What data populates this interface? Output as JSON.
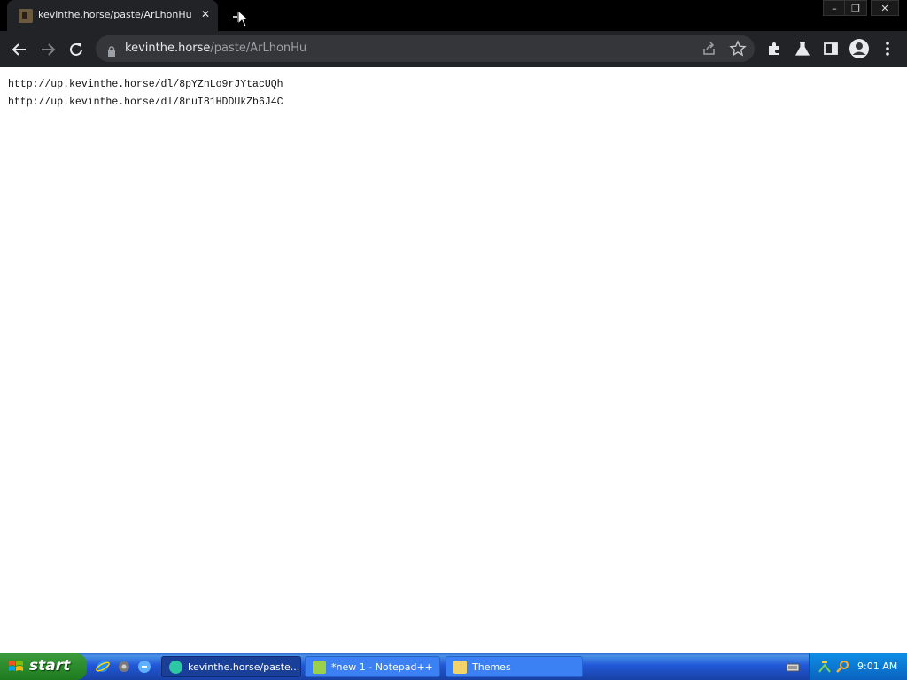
{
  "browser": {
    "tab": {
      "title": "kevinthe.horse/paste/ArLhonHu",
      "close_glyph": "✕"
    },
    "window_controls": {
      "minimize": "–",
      "restore": "❐",
      "close": "✕"
    },
    "omnibox": {
      "host": "kevinthe.horse",
      "path": "/paste/ArLhonHu"
    }
  },
  "page": {
    "lines": [
      "http://up.kevinthe.horse/dl/8pYZnLo9rJYtacUQh",
      "http://up.kevinthe.horse/dl/8nuI81HDDUkZb6J4C"
    ]
  },
  "taskbar": {
    "start_label": "start",
    "items": [
      {
        "label": "kevinthe.horse/paste...",
        "active": true
      },
      {
        "label": "*new 1 - Notepad++",
        "active": false
      },
      {
        "label": "Themes",
        "active": false
      }
    ],
    "clock": "9:01 AM"
  },
  "colors": {
    "chrome_dark": "#222326",
    "omnibox": "#35363a",
    "xp_blue": "#2157d7",
    "xp_green": "#2f8f2f"
  }
}
